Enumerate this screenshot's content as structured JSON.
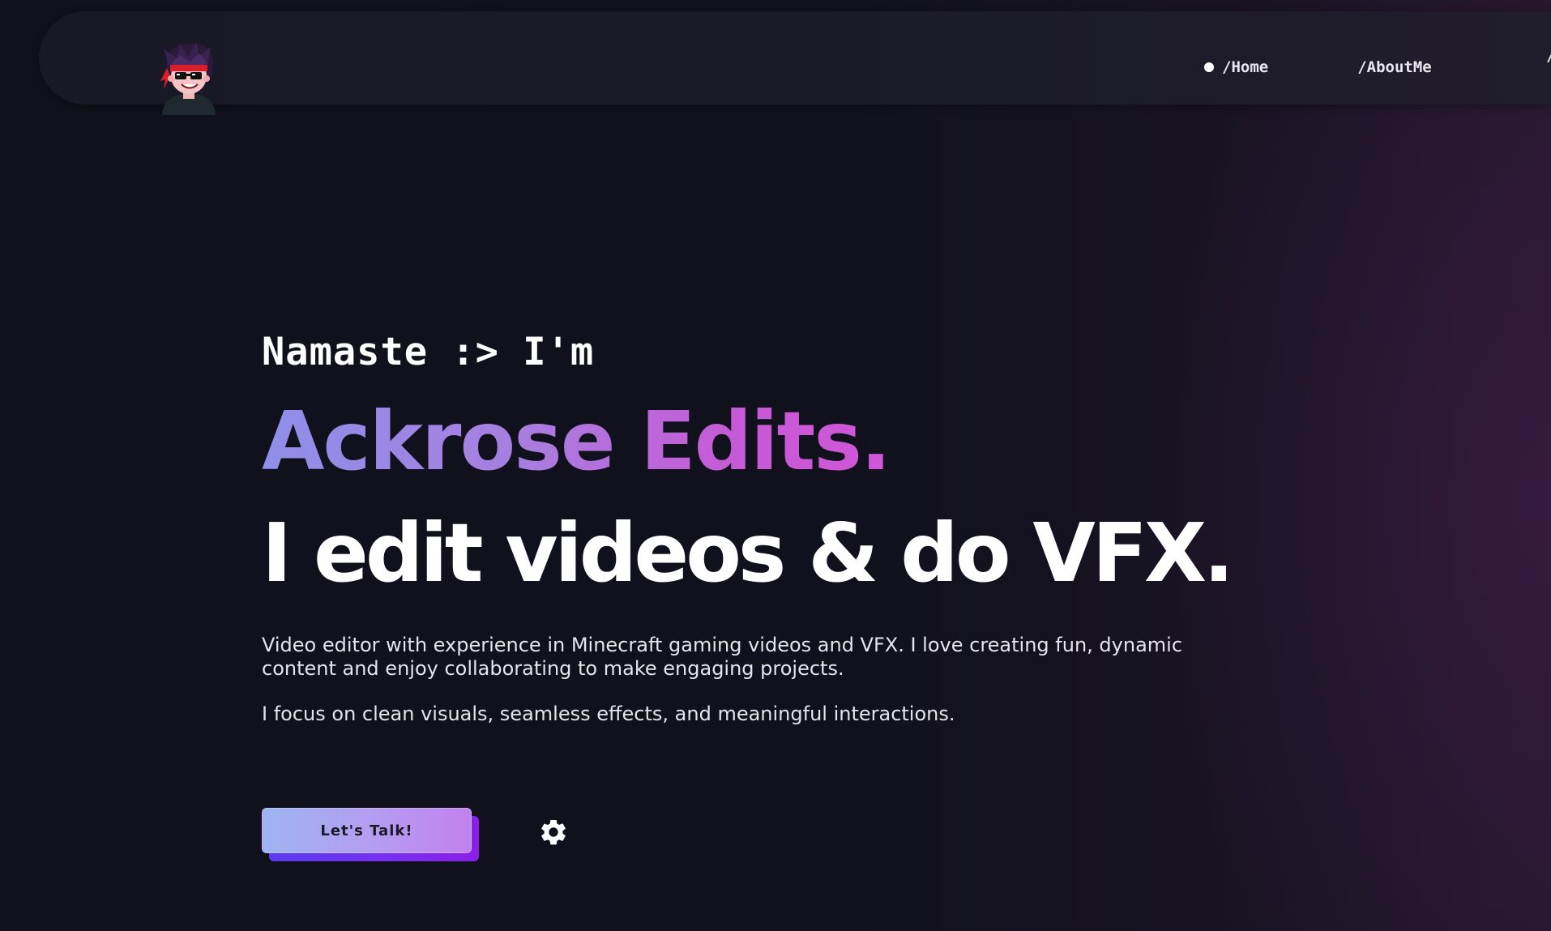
{
  "nav": {
    "links": [
      {
        "label": "/Home",
        "active": true
      },
      {
        "label": "/AboutMe",
        "active": false
      }
    ],
    "clipped_label": "/"
  },
  "hero": {
    "greeting": "Namaste :> I'm",
    "name": "Ackrose Edits.",
    "tagline": "I edit videos & do VFX.",
    "description": "Video editor with experience in Minecraft gaming videos and VFX. I love creating fun, dynamic content and enjoy collaborating to make engaging projects.",
    "description2": "I focus on clean visuals, seamless effects, and meaningful interactions."
  },
  "cta": {
    "label": "Let's Talk!"
  },
  "icons": {
    "settings": "gear-icon",
    "logo": "avatar-logo"
  },
  "colors": {
    "background": "#11111d",
    "accent_start": "#8f8fe8",
    "accent_end": "#d156d8",
    "button_shadow": "#7a2ff0"
  }
}
